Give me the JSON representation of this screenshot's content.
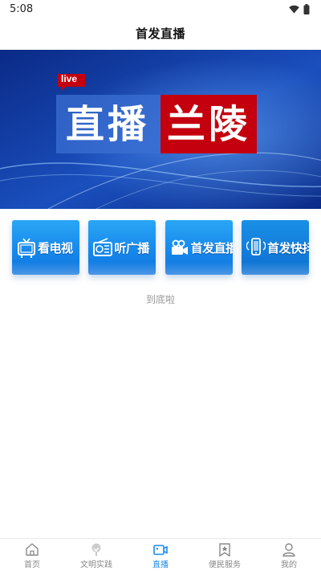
{
  "status_bar": {
    "time": "5:08"
  },
  "header": {
    "title": "首发直播"
  },
  "banner": {
    "badge": "live",
    "title_left": "直播",
    "title_right": "兰陵"
  },
  "quick_links": [
    {
      "label": "看电视",
      "icon": "tv-icon"
    },
    {
      "label": "听广播",
      "icon": "radio-icon"
    },
    {
      "label": "首发直播",
      "icon": "camera-icon"
    },
    {
      "label": "首发快抖",
      "icon": "phone-icon"
    }
  ],
  "end_of_list": "到底啦",
  "tab_bar": {
    "items": [
      {
        "label": "首页",
        "icon": "home-icon",
        "active": false
      },
      {
        "label": "文明实践",
        "icon": "tree-icon",
        "active": false
      },
      {
        "label": "直播",
        "icon": "video-icon",
        "active": true
      },
      {
        "label": "便民服务",
        "icon": "bookmark-star-icon",
        "active": false
      },
      {
        "label": "我的",
        "icon": "user-icon",
        "active": false
      }
    ]
  },
  "colors": {
    "accent": "#1a8be8",
    "banner_blue": "#0b2f8f",
    "banner_red": "#c4000e"
  }
}
